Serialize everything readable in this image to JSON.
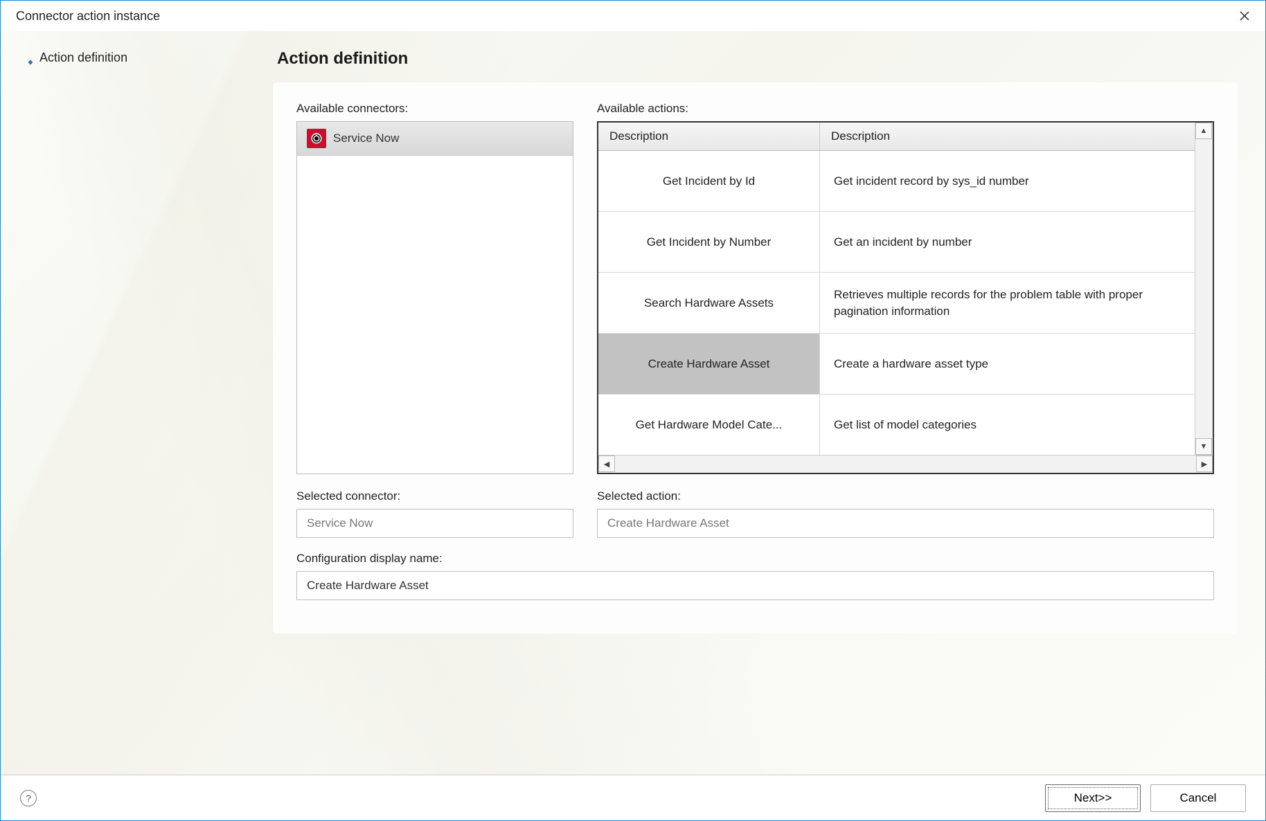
{
  "window": {
    "title": "Connector action instance"
  },
  "sidebar": {
    "step_label": "Action definition"
  },
  "main": {
    "heading": "Action definition",
    "available_connectors_label": "Available connectors:",
    "available_actions_label": "Available actions:",
    "connectors": [
      {
        "name": "Service Now"
      }
    ],
    "actions_table": {
      "col1_header": "Description",
      "col2_header": "Description",
      "rows": [
        {
          "name": "Get Incident by Id",
          "desc": "Get incident record by sys_id number",
          "selected": false
        },
        {
          "name": "Get Incident by Number",
          "desc": "Get an incident by number",
          "selected": false
        },
        {
          "name": "Search Hardware Assets",
          "desc": "Retrieves multiple records for the problem table with proper pagination information",
          "selected": false
        },
        {
          "name": "Create Hardware Asset",
          "desc": "Create a hardware asset type",
          "selected": true
        },
        {
          "name": "Get Hardware Model Cate...",
          "desc": "Get list of model categories",
          "selected": false
        }
      ]
    },
    "selected_connector_label": "Selected connector:",
    "selected_connector_value": "Service Now",
    "selected_action_label": "Selected action:",
    "selected_action_value": "Create Hardware Asset",
    "config_name_label": "Configuration display name:",
    "config_name_value": "Create Hardware Asset"
  },
  "footer": {
    "next_label": "Next>>",
    "cancel_label": "Cancel"
  }
}
